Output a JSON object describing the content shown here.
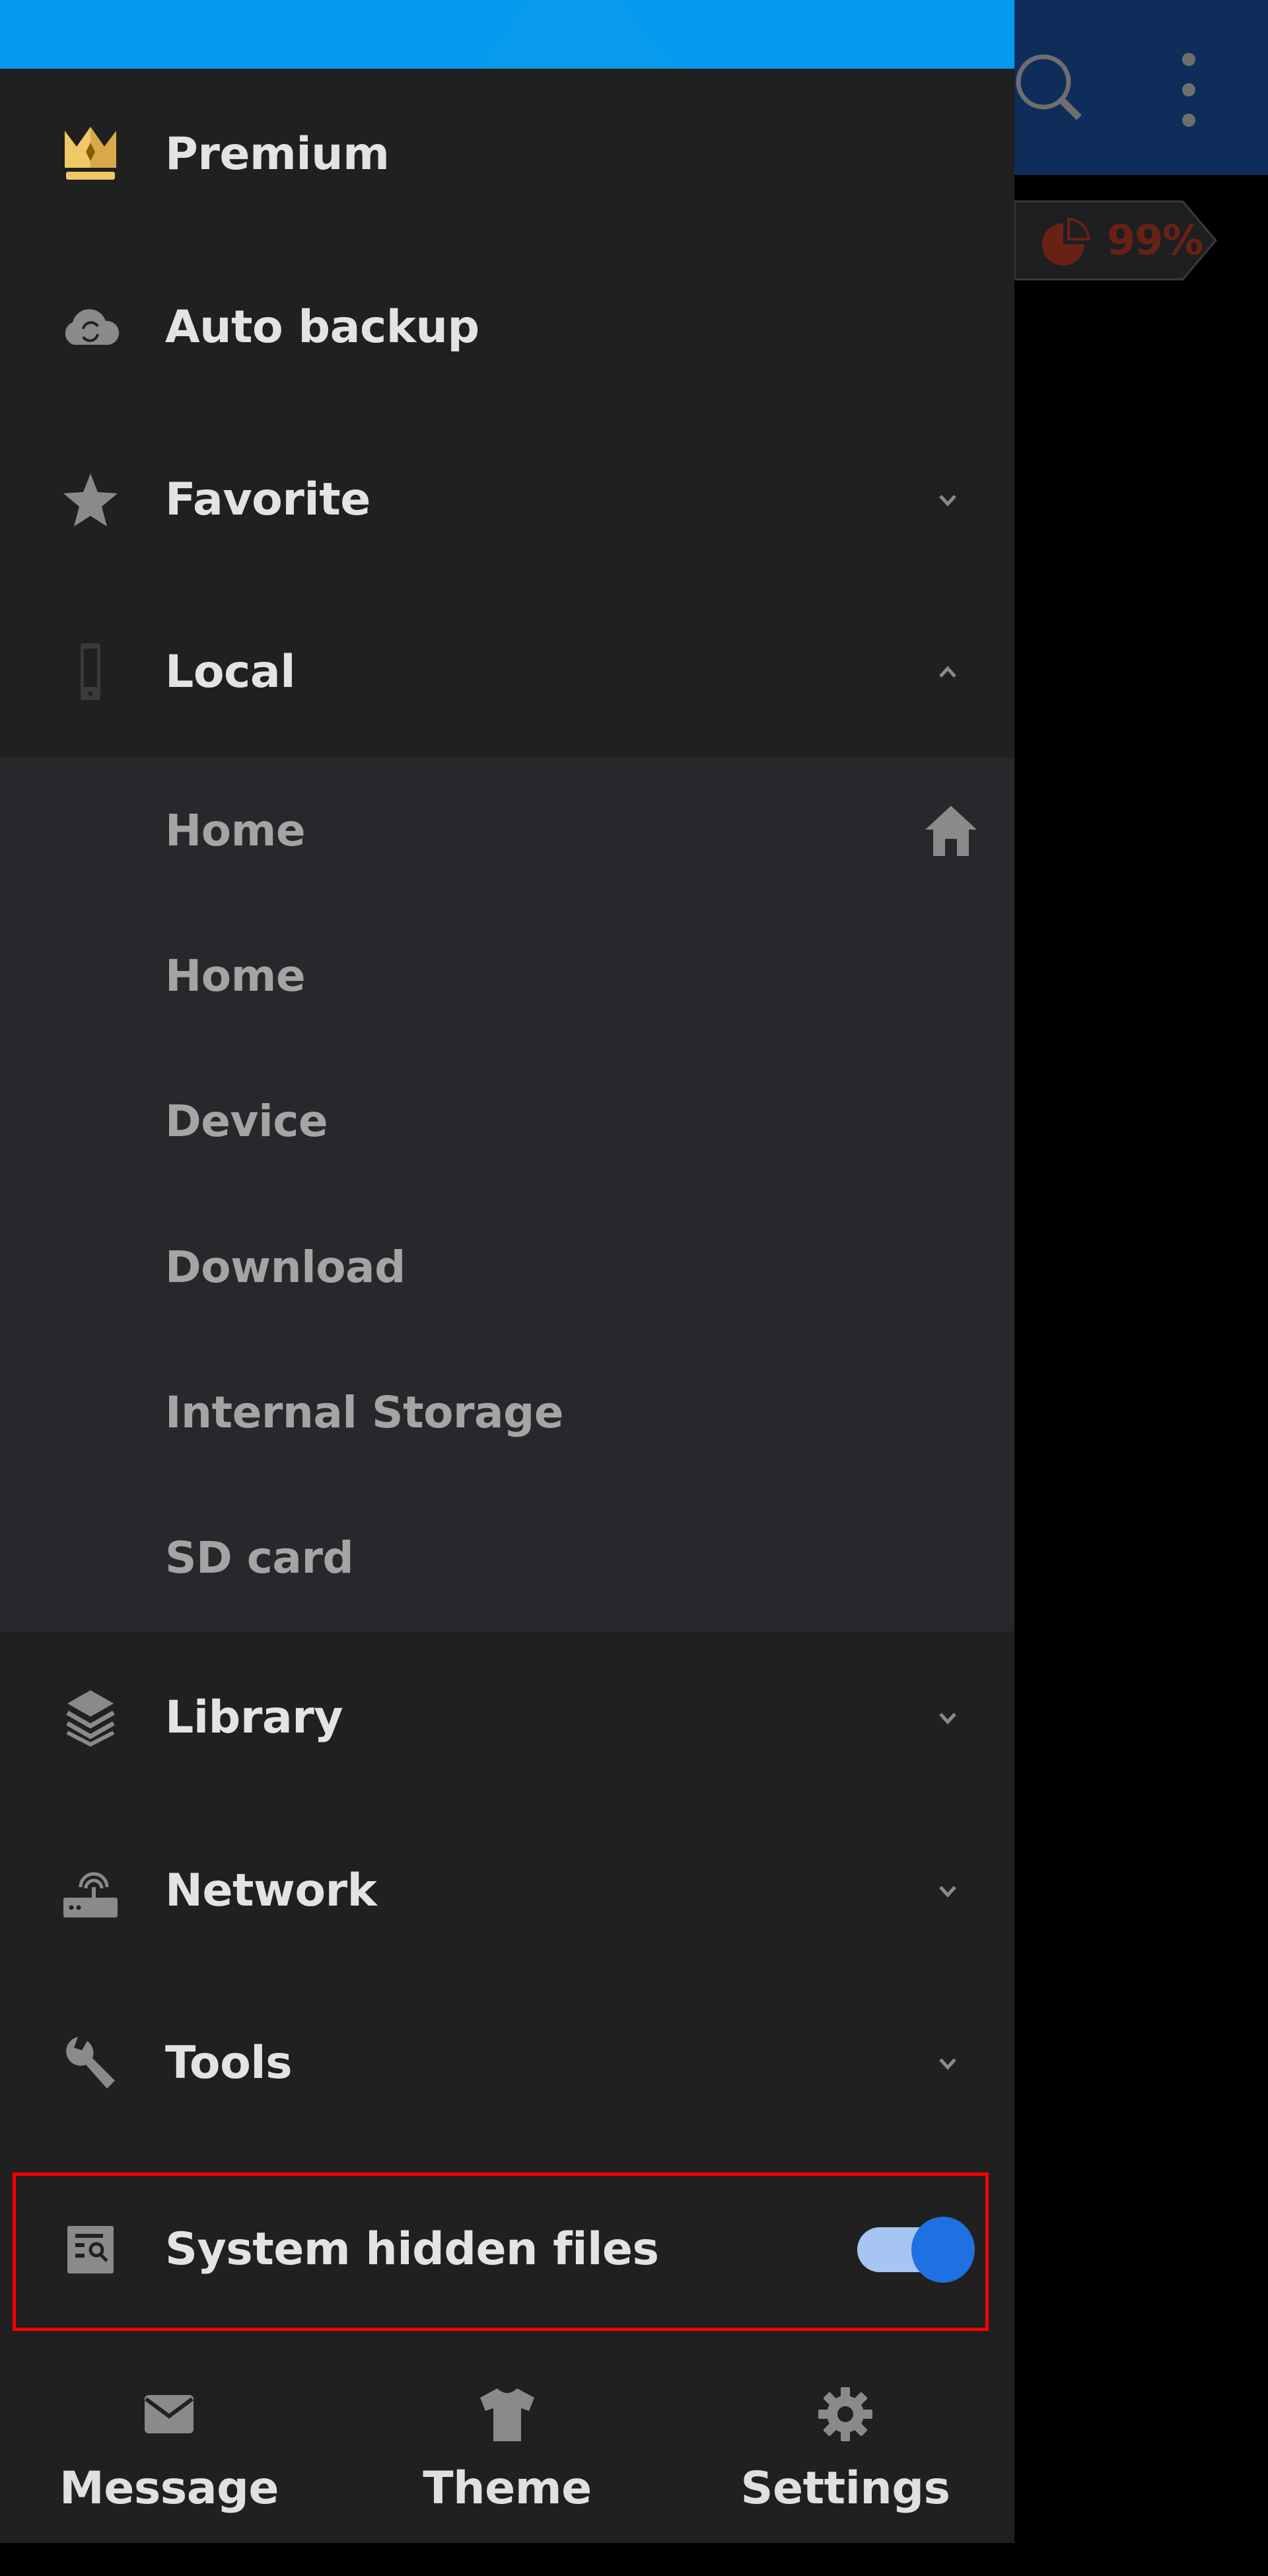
{
  "app_bar": {
    "search_icon": "search-icon",
    "more_icon": "more-vert-icon",
    "background_color": "#0e2d5a"
  },
  "storage_badge": {
    "icon": "pie-chart-icon",
    "value_text": "99%",
    "value_percent": 99,
    "color": "#6a2115"
  },
  "drawer": {
    "header_color": "#0599ef",
    "items": [
      {
        "label": "Premium",
        "icon": "crown-icon",
        "chevron": null
      },
      {
        "label": "Auto backup",
        "icon": "cloud-sync-icon",
        "chevron": null
      },
      {
        "label": "Favorite",
        "icon": "star-icon",
        "chevron": "chevron-down"
      },
      {
        "label": "Local",
        "icon": "phone-icon",
        "chevron": "chevron-up",
        "expanded": true
      }
    ],
    "local_children": [
      {
        "label": "Home",
        "trailing_icon": "home-icon"
      },
      {
        "label": "Home"
      },
      {
        "label": "Device"
      },
      {
        "label": "Download"
      },
      {
        "label": "Internal Storage"
      },
      {
        "label": "SD card"
      }
    ],
    "items_after": [
      {
        "label": "Library",
        "icon": "layers-icon",
        "chevron": "chevron-down"
      },
      {
        "label": "Network",
        "icon": "router-icon",
        "chevron": "chevron-down"
      },
      {
        "label": "Tools",
        "icon": "wrench-icon",
        "chevron": "chevron-down"
      }
    ],
    "hidden_files": {
      "label": "System hidden files",
      "icon": "hidden-file-search-icon",
      "toggle_on": true,
      "accent_color": "#1f70e0"
    },
    "bottom_tabs": [
      {
        "label": "Message",
        "icon": "mail-icon"
      },
      {
        "label": "Theme",
        "icon": "tshirt-icon"
      },
      {
        "label": "Settings",
        "icon": "gear-icon"
      }
    ]
  }
}
